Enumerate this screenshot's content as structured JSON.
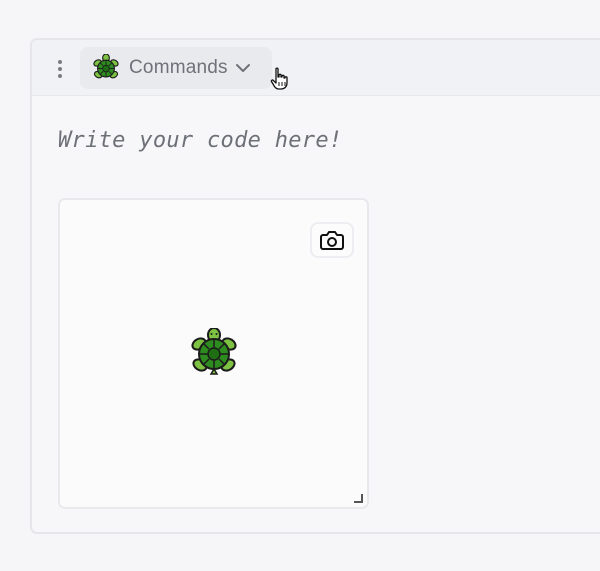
{
  "cell": {
    "mode_label": "Commands",
    "code_placeholder": "Write your code here!"
  },
  "icons": {
    "handle": "drag-handle-icon",
    "mode": "turtle-icon",
    "dropdown": "chevron-down-icon",
    "camera": "camera-icon",
    "sprite": "turtle-sprite",
    "resize": "resize-handle-icon",
    "cursor": "hand-pointer-cursor"
  },
  "colors": {
    "turtle_shell": "#2e8b1f",
    "turtle_skin": "#7dc242",
    "outline": "#1b1b1b",
    "label": "#6f727a"
  }
}
